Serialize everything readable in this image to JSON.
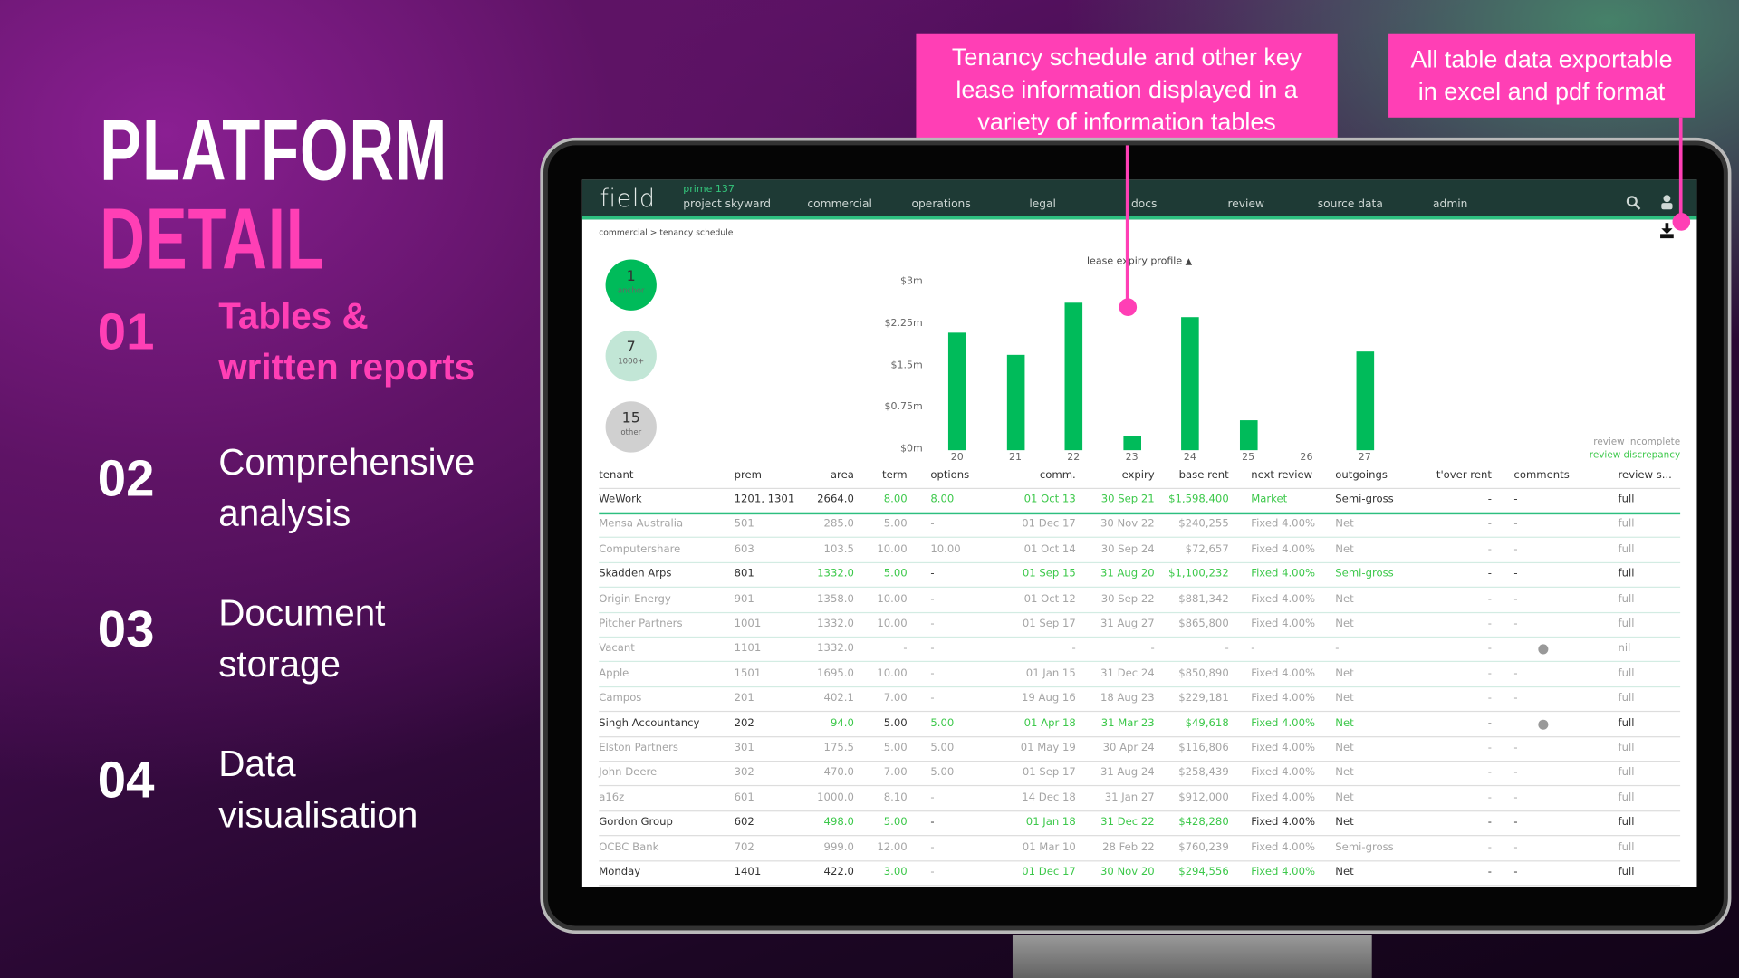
{
  "slide": {
    "title_line1": "PLATFORM",
    "title_line2": "DETAIL",
    "features": [
      {
        "num": "01",
        "text": "Tables & written reports",
        "lines": [
          "Tables &",
          "written reports"
        ],
        "highlight": true
      },
      {
        "num": "02",
        "text": "Comprehensive analysis",
        "lines": [
          "Comprehensive",
          "analysis"
        ],
        "highlight": false
      },
      {
        "num": "03",
        "text": "Document storage",
        "lines": [
          "Document",
          "storage"
        ],
        "highlight": false
      },
      {
        "num": "04",
        "text": "Data visualisation",
        "lines": [
          "Data",
          "visualisation"
        ],
        "highlight": false
      }
    ],
    "callouts": [
      "Tenancy schedule and other key lease information displayed in a variety of information tables",
      "All table data exportable in excel and pdf format"
    ],
    "accent": "#ff3fb5"
  },
  "app": {
    "logo": "field",
    "project_code": "prime 137",
    "project_name": "project skyward",
    "nav": [
      "commercial",
      "operations",
      "legal",
      "docs",
      "review",
      "source data",
      "admin"
    ],
    "icons": [
      "search-icon",
      "user-icon",
      "download-icon"
    ],
    "breadcrumb": "commercial > tenancy schedule",
    "colors": {
      "navbar": "#1e3a35",
      "accent_green": "#2dbf7f",
      "bar": "#00bb5a",
      "text_green": "#3cc84a"
    },
    "summary": [
      {
        "count": "1",
        "label": "anchor",
        "color": "#00bb5a"
      },
      {
        "count": "7",
        "label": "1000+",
        "color": "#c2e6d6"
      },
      {
        "count": "15",
        "label": "other",
        "color": "#d0d0d0"
      }
    ],
    "legend": {
      "incomplete": "review incomplete",
      "discrepancy": "review discrepancy"
    }
  },
  "chart_data": {
    "type": "bar",
    "title": "lease expiry profile",
    "categories": [
      "20",
      "21",
      "22",
      "23",
      "24",
      "25",
      "26",
      "27"
    ],
    "values": [
      2.1,
      1.71,
      2.64,
      0.26,
      2.39,
      0.54,
      0,
      1.77
    ],
    "yticks": [
      "$0m",
      "$0.75m",
      "$1.5m",
      "$2.25m",
      "$3m"
    ],
    "ylim": [
      0,
      3
    ],
    "yunit": "$m",
    "grid": false
  },
  "table": {
    "columns": [
      "tenant",
      "prem",
      "area",
      "term",
      "options",
      "comm.",
      "expiry",
      "base rent",
      "next review",
      "outgoings",
      "t'over rent",
      "comments",
      "review s..."
    ],
    "rows": [
      {
        "cells": [
          "WeWork",
          "1201, 1301",
          "2664.0",
          "8.00",
          "8.00",
          "01 Oct 13",
          "30 Sep 21",
          "$1,598,400",
          "Market",
          "Semi-gross",
          "-",
          "-",
          "full"
        ],
        "tones": "dddGGGGGGdddd",
        "comment_dot": false,
        "selected": true
      },
      {
        "cells": [
          "Mensa Australia",
          "501",
          "285.0",
          "5.00",
          "-",
          "01 Dec 17",
          "30 Nov 22",
          "$240,255",
          "Fixed 4.00%",
          "Net",
          "-",
          "-",
          "full"
        ],
        "tones": "ggggggggggggg",
        "comment_dot": false
      },
      {
        "cells": [
          "Computershare",
          "603",
          "103.5",
          "10.00",
          "10.00",
          "01 Oct 14",
          "30 Sep 24",
          "$72,657",
          "Fixed 4.00%",
          "Net",
          "-",
          "-",
          "full"
        ],
        "tones": "ggggggggggggg",
        "comment_dot": false
      },
      {
        "cells": [
          "Skadden Arps",
          "801",
          "1332.0",
          "5.00",
          "-",
          "01 Sep 15",
          "31 Aug 20",
          "$1,100,232",
          "Fixed 4.00%",
          "Semi-gross",
          "-",
          "-",
          "full"
        ],
        "tones": "ddGGdGGGGGddd",
        "comment_dot": false
      },
      {
        "cells": [
          "Origin Energy",
          "901",
          "1358.0",
          "10.00",
          "-",
          "01 Oct 12",
          "30 Sep 22",
          "$881,342",
          "Fixed 4.00%",
          "Net",
          "-",
          "-",
          "full"
        ],
        "tones": "ggggggggggggg",
        "comment_dot": false
      },
      {
        "cells": [
          "Pitcher Partners",
          "1001",
          "1332.0",
          "10.00",
          "-",
          "01 Sep 17",
          "31 Aug 27",
          "$865,800",
          "Fixed 4.00%",
          "Net",
          "-",
          "-",
          "full"
        ],
        "tones": "ggggggggggggg",
        "comment_dot": false
      },
      {
        "cells": [
          "Vacant",
          "1101",
          "1332.0",
          "-",
          "-",
          "-",
          "-",
          "-",
          "-",
          "-",
          "-",
          "",
          "nil"
        ],
        "tones": "ggggggggggggg",
        "comment_dot": true
      },
      {
        "cells": [
          "Apple",
          "1501",
          "1695.0",
          "10.00",
          "-",
          "01 Jan 15",
          "31 Dec 24",
          "$850,890",
          "Fixed 4.00%",
          "Net",
          "-",
          "-",
          "full"
        ],
        "tones": "ggggggggggggg",
        "comment_dot": false
      },
      {
        "cells": [
          "Campos",
          "201",
          "402.1",
          "7.00",
          "-",
          "19 Aug 16",
          "18 Aug 23",
          "$229,181",
          "Fixed 4.00%",
          "Net",
          "-",
          "-",
          "full"
        ],
        "tones": "ggggggggggggg",
        "comment_dot": false
      },
      {
        "cells": [
          "Singh Accountancy",
          "202",
          "94.0",
          "5.00",
          "5.00",
          "01 Apr 18",
          "31 Mar 23",
          "$49,618",
          "Fixed 4.00%",
          "Net",
          "-",
          "",
          "full"
        ],
        "tones": "ddGdGGGGGGddd",
        "comment_dot": true
      },
      {
        "cells": [
          "Elston Partners",
          "301",
          "175.5",
          "5.00",
          "5.00",
          "01 May 19",
          "30 Apr 24",
          "$116,806",
          "Fixed 4.00%",
          "Net",
          "-",
          "-",
          "full"
        ],
        "tones": "ggggggggggggg",
        "comment_dot": false
      },
      {
        "cells": [
          "John Deere",
          "302",
          "470.0",
          "7.00",
          "5.00",
          "01 Sep 17",
          "31 Aug 24",
          "$258,439",
          "Fixed 4.00%",
          "Net",
          "-",
          "-",
          "full"
        ],
        "tones": "ggggggggggggg",
        "comment_dot": false
      },
      {
        "cells": [
          "a16z",
          "601",
          "1000.0",
          "8.10",
          "-",
          "14 Dec 18",
          "31 Jan 27",
          "$912,000",
          "Fixed 4.00%",
          "Net",
          "-",
          "-",
          "full"
        ],
        "tones": "ggggggggggggg",
        "comment_dot": false
      },
      {
        "cells": [
          "Gordon Group",
          "602",
          "498.0",
          "5.00",
          "-",
          "01 Jan 18",
          "31 Dec 22",
          "$428,280",
          "Fixed 4.00%",
          "Net",
          "-",
          "-",
          "full"
        ],
        "tones": "ddGGdGGGddddd",
        "comment_dot": false
      },
      {
        "cells": [
          "OCBC Bank",
          "702",
          "999.0",
          "12.00",
          "-",
          "01 Mar 10",
          "28 Feb 22",
          "$760,239",
          "Fixed 4.00%",
          "Semi-gross",
          "-",
          "-",
          "full"
        ],
        "tones": "ggggggggggggg",
        "comment_dot": false
      },
      {
        "cells": [
          "Monday",
          "1401",
          "422.0",
          "3.00",
          "-",
          "01 Dec 17",
          "30 Nov 20",
          "$294,556",
          "Fixed 4.00%",
          "Net",
          "-",
          "-",
          "full"
        ],
        "tones": "dddGgGGGGdddd",
        "comment_dot": false
      }
    ]
  }
}
